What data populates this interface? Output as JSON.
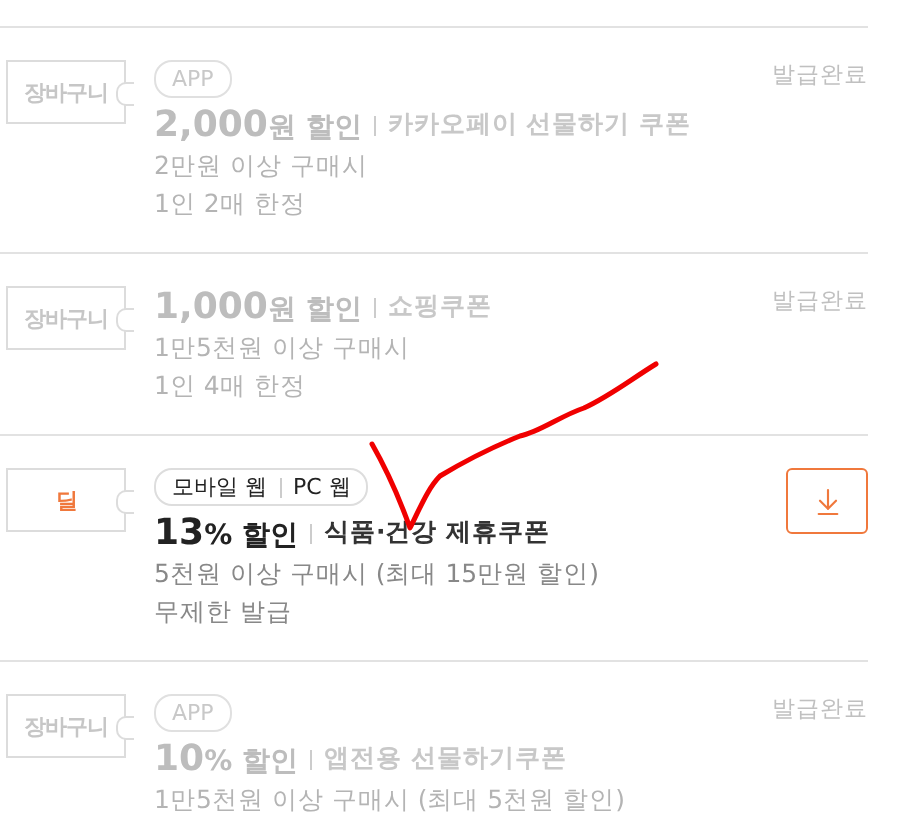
{
  "coupons": [
    {
      "kind": "issued",
      "ticket": "장바구니",
      "tags": [
        {
          "label": "APP"
        }
      ],
      "amount": "2,000",
      "unit": "원 할인",
      "name": "카카오페이 선물하기 쿠폰",
      "conditions": [
        "2만원 이상 구매시",
        "1인 2매 한정"
      ],
      "status": "발급완료"
    },
    {
      "kind": "issued",
      "ticket": "장바구니",
      "amount": "1,000",
      "unit": "원 할인",
      "name": "쇼핑쿠폰",
      "conditions": [
        "1만5천원 이상 구매시",
        "1인 4매 한정"
      ],
      "status": "발급완료"
    },
    {
      "kind": "available",
      "ticket": "딜",
      "tags": [
        {
          "label": "모바일 웹"
        },
        {
          "label": "PC 웹"
        }
      ],
      "amount": "13",
      "unit": "% 할인",
      "name": "식품·건강 제휴쿠폰",
      "conditions": [
        "5천원 이상 구매시 (최대 15만원 할인)",
        "무제한 발급"
      ]
    },
    {
      "kind": "issued",
      "ticket": "장바구니",
      "tags": [
        {
          "label": "APP"
        }
      ],
      "amount": "10",
      "unit": "% 할인",
      "name": "앱전용 선물하기쿠폰",
      "conditions": [
        "1만5천원 이상 구매시 (최대 5천원 할인)"
      ],
      "status": "발급완료"
    }
  ]
}
